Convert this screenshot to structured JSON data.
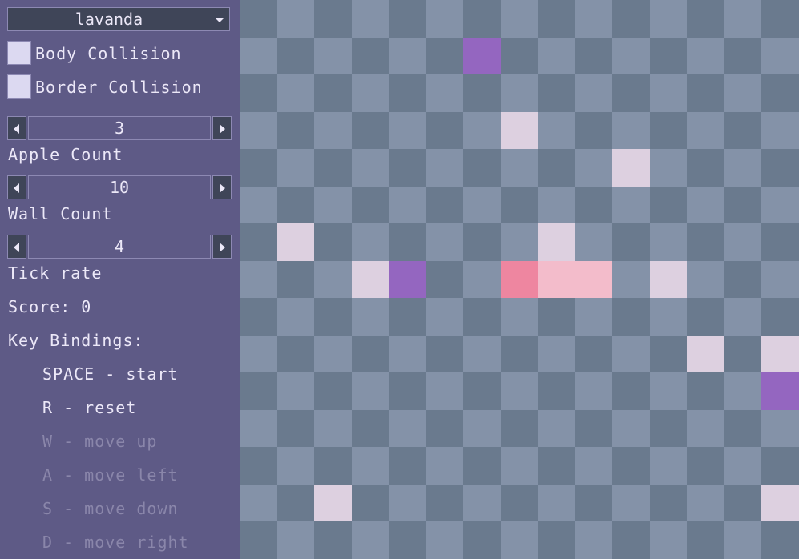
{
  "theme": {
    "selected": "lavanda"
  },
  "options": {
    "body_collision": "Body Collision",
    "border_collision": "Border Collision"
  },
  "settings": {
    "apple_count": {
      "value": "3",
      "label": "Apple Count"
    },
    "wall_count": {
      "value": "10",
      "label": "Wall Count"
    },
    "tick_rate": {
      "value": "4",
      "label": "Tick rate"
    }
  },
  "score": "Score: 0",
  "bindings": {
    "title": "Key Bindings:",
    "items": [
      {
        "text": "SPACE - start",
        "active": true
      },
      {
        "text": "R - reset",
        "active": true
      },
      {
        "text": "W - move up",
        "active": false
      },
      {
        "text": "A - move left",
        "active": false
      },
      {
        "text": "S - move down",
        "active": false
      },
      {
        "text": "D - move right",
        "active": false
      }
    ]
  },
  "colors": {
    "tile_light": "#8492a8",
    "tile_dark": "#6a7a8e",
    "apple": "#ddd0e0",
    "wall": "#9466c0",
    "snake_head": "#ee86a0",
    "snake_body": "#f3bccb"
  },
  "board": {
    "cols": 15,
    "rows": 15,
    "apples": [
      [
        7,
        3
      ],
      [
        10,
        4
      ],
      [
        1,
        6
      ],
      [
        8,
        6
      ],
      [
        3,
        7
      ],
      [
        11,
        7
      ],
      [
        12,
        9
      ],
      [
        14,
        9
      ],
      [
        2,
        13
      ],
      [
        14,
        13
      ]
    ],
    "walls": [
      [
        6,
        1
      ],
      [
        4,
        7
      ],
      [
        14,
        10
      ]
    ],
    "snake": [
      [
        7,
        7
      ],
      [
        8,
        7
      ],
      [
        9,
        7
      ]
    ]
  }
}
